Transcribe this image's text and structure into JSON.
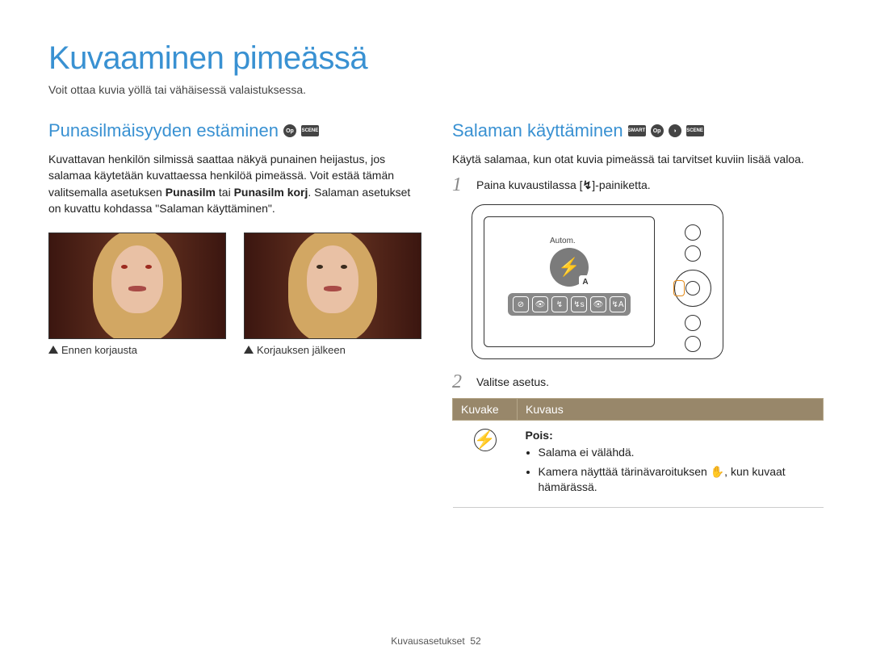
{
  "title": "Kuvaaminen pimeässä",
  "subtitle": "Voit ottaa kuvia yöllä tai vähäisessä valaistuksessa.",
  "left": {
    "heading": "Punasilmäisyyden estäminen",
    "para_a": "Kuvattavan henkilön silmissä saattaa näkyä punainen heijastus, jos salamaa käytetään kuvattaessa henkilöä pimeässä. Voit estää tämän valitsemalla asetuksen ",
    "bold1": "Punasilm",
    "para_b": " tai ",
    "bold2": "Punasilm korj",
    "para_c": ". Salaman asetukset on kuvattu kohdassa \"Salaman käyttäminen\".",
    "cap_before": "Ennen korjausta",
    "cap_after": "Korjauksen jälkeen"
  },
  "right": {
    "heading": "Salaman käyttäminen",
    "para": "Käytä salamaa, kun otat kuvia pimeässä tai tarvitset kuviin lisää valoa.",
    "step1_num": "1",
    "step1_a": "Paina kuvaustilassa [",
    "step1_glyph": "↯",
    "step1_b": "]-painiketta.",
    "camera_label": "Autom.",
    "camera_badge": "A",
    "step2_num": "2",
    "step2": "Valitse asetus.",
    "table": {
      "h_icon": "Kuvake",
      "h_desc": "Kuvaus",
      "row0_icon": "⊘",
      "row0_title": "Pois",
      "row0_b1": "Salama ei välähdä.",
      "row0_b2_a": "Kamera näyttää tärinävaroituksen ",
      "row0_b2_glyph": "✋",
      "row0_b2_b": ", kun kuvaat hämärässä."
    }
  },
  "footer": {
    "section": "Kuvausasetukset",
    "page": "52"
  }
}
